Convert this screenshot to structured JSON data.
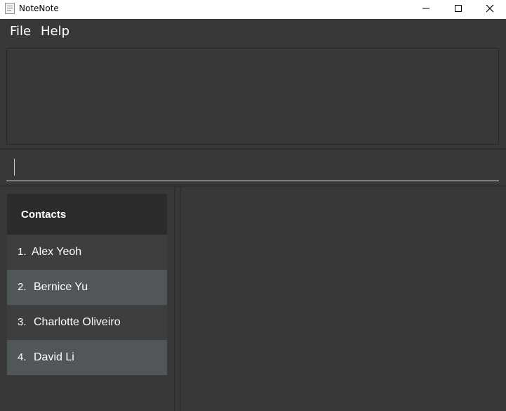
{
  "window": {
    "title": "NoteNote",
    "icon": "notebook-app-icon",
    "controls": [
      "minimize-icon",
      "maximize-icon",
      "close-icon"
    ]
  },
  "menu": {
    "file_label": "File",
    "help_label": "Help"
  },
  "result_display": {
    "text": ""
  },
  "command_box": {
    "value": ""
  },
  "contacts": {
    "header": "Contacts",
    "items": [
      {
        "index": "1.",
        "name": "Alex Yeoh"
      },
      {
        "index": "2.",
        "name": "Bernice Yu"
      },
      {
        "index": "3.",
        "name": "Charlotte Oliveiro"
      },
      {
        "index": "4.",
        "name": "David Li"
      }
    ]
  },
  "colors": {
    "background": "#383838",
    "header_bg": "#2b2b2b",
    "row_odd": "#3c3e3f",
    "row_even": "#515658",
    "text": "#ffffff"
  }
}
